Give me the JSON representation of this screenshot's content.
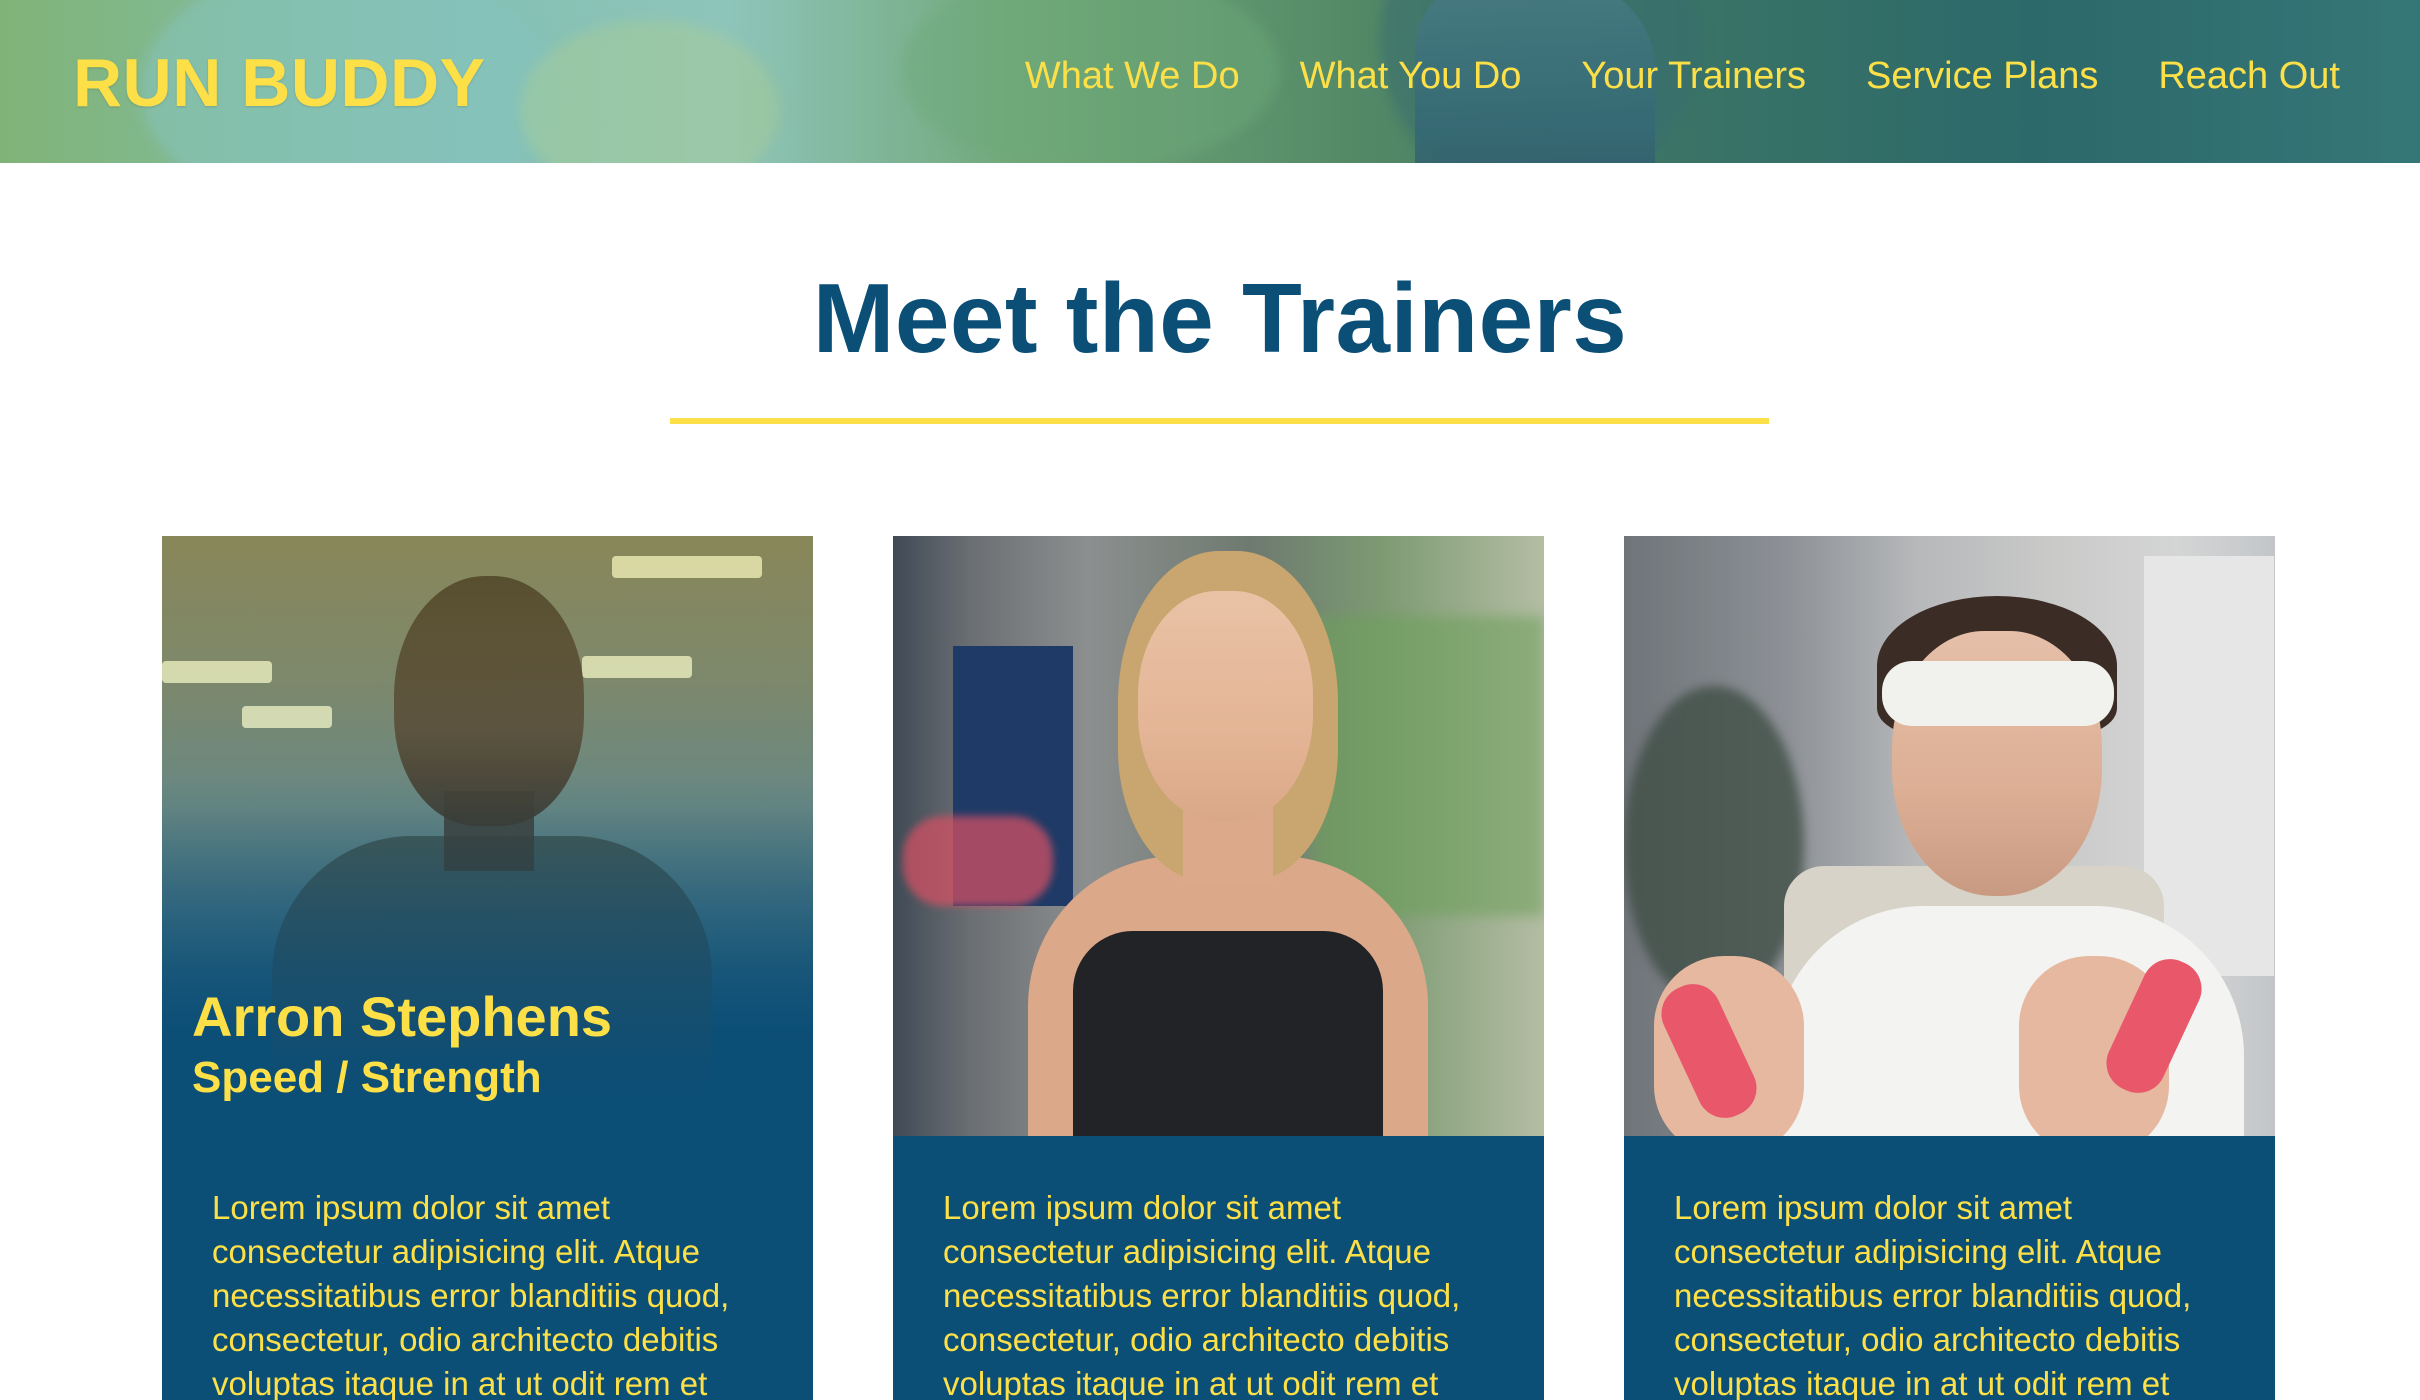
{
  "header": {
    "brand": "RUN BUDDY",
    "nav": [
      {
        "label": "What We Do"
      },
      {
        "label": "What You Do"
      },
      {
        "label": "Your Trainers"
      },
      {
        "label": "Service Plans"
      },
      {
        "label": "Reach Out"
      }
    ]
  },
  "section": {
    "title": "Meet the Trainers"
  },
  "trainers": [
    {
      "name": "Arron Stephens",
      "specialty": "Speed / Strength",
      "bio": "Lorem ipsum dolor sit amet consectetur adipisicing elit. Atque necessitatibus error blanditiis quod, consectetur, odio architecto debitis voluptas itaque in at ut odit rem et"
    },
    {
      "bio": "Lorem ipsum dolor sit amet consectetur adipisicing elit. Atque necessitatibus error blanditiis quod, consectetur, odio architecto debitis voluptas itaque in at ut odit rem et"
    },
    {
      "bio": "Lorem ipsum dolor sit amet consectetur adipisicing elit. Atque necessitatibus error blanditiis quod, consectetur, odio architecto debitis voluptas itaque in at ut odit rem et"
    }
  ],
  "colors": {
    "brand_yellow": "#fde047",
    "brand_blue": "#0b4e76"
  }
}
